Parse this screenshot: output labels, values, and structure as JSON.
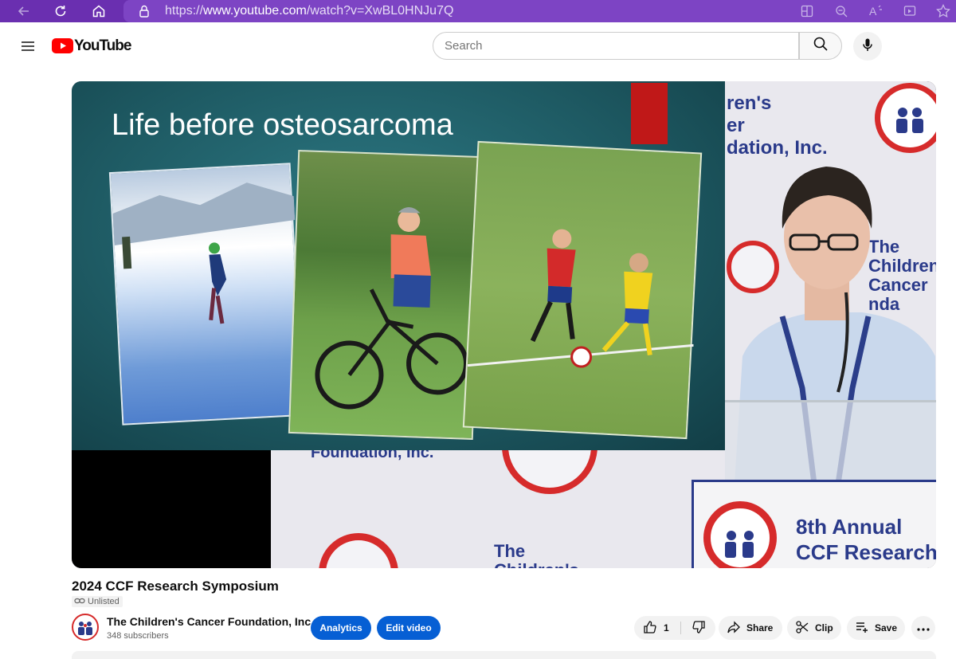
{
  "browser": {
    "url_prefix": "https://",
    "url_domain": "www.youtube.com",
    "url_path": "/watch?v=XwBL0HNJu7Q"
  },
  "header": {
    "logo_text": "YouTube",
    "search_placeholder": "Search"
  },
  "video": {
    "slide_title": "Life before osteosarcoma",
    "banner_fragment_1": "ren's",
    "banner_fragment_2": "er",
    "banner_fragment_3": "dation, Inc.",
    "banner_fragment_4": "The",
    "banner_fragment_5": "Children's",
    "banner_fragment_6": "Cancer",
    "banner_fragment_7": "nda",
    "lower_banner_1": "Foundation, Inc.",
    "lower_banner_2": "The",
    "lower_banner_3": "Children's",
    "podium_line_1": "8th Annual",
    "podium_line_2": "CCF Research",
    "seal_text": "The Children's Cancer Foundation"
  },
  "meta": {
    "title": "2024 CCF Research Symposium",
    "visibility": "Unlisted",
    "channel_name": "The Children's Cancer Foundation, Inc.",
    "subscribers": "348 subscribers"
  },
  "actions": {
    "analytics": "Analytics",
    "edit_video": "Edit video",
    "like_count": "1",
    "share": "Share",
    "clip": "Clip",
    "save": "Save"
  },
  "colors": {
    "browser_bar": "#6a2fb0",
    "brand_red": "#ff0000",
    "primary_blue": "#065fd4",
    "slide_teal": "#1e5a63",
    "ccf_red": "#d62b2b",
    "ccf_navy": "#2a3a8a"
  },
  "icons": [
    "back-icon",
    "reload-icon",
    "home-icon",
    "lock-icon",
    "split-screen-icon",
    "zoom-icon",
    "read-aloud-icon",
    "immersive-reader-icon",
    "favorite-star-icon",
    "menu-icon",
    "youtube-logo-icon",
    "search-icon",
    "mic-icon",
    "link-icon",
    "thumbs-up-icon",
    "thumbs-down-icon",
    "share-icon",
    "scissors-icon",
    "playlist-add-icon",
    "more-icon"
  ]
}
